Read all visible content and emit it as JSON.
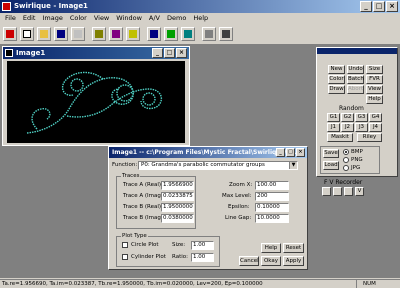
{
  "app": {
    "title": "Swirlique - Image1"
  },
  "menu": [
    "File",
    "Edit",
    "Image",
    "Color",
    "View",
    "Window",
    "A/V",
    "Demo",
    "Help"
  ],
  "child_window": {
    "title": "Image1"
  },
  "palette": {
    "row1": [
      "New",
      "Undo",
      "Size"
    ],
    "row2": [
      "Color",
      "Batch",
      "FVR"
    ],
    "row3": [
      "Draw",
      "Abort",
      "View"
    ],
    "help": "Help",
    "random_label": "Random",
    "random_row1": [
      "G1",
      "G2",
      "G3",
      "G4"
    ],
    "random_row2": [
      "J1",
      "J2",
      "J3",
      "J4"
    ],
    "maskit": "Maskit",
    "riley": "Riley",
    "save": "Save",
    "load": "Load",
    "formats": [
      "BMP",
      "PNG",
      "JPG"
    ],
    "fv_recorder": "F V Recorder",
    "v_btn": "V"
  },
  "dialog": {
    "title": "Image1 -- c:\\Program Files\\Mystic Fractal\\Swirlique\\Ut...",
    "function_label": "Function:",
    "function_value": "P0: Grandma's parabolic commutator groups",
    "traces_label": "Traces",
    "traces": [
      {
        "label": "Trace A (Real):",
        "value": "1.95669000"
      },
      {
        "label": "Trace A (Imag):",
        "value": "0.02338750"
      },
      {
        "label": "Trace B (Real):",
        "value": "1.95000000"
      },
      {
        "label": "Trace B (Imag):",
        "value": "0.03800000"
      }
    ],
    "params": [
      {
        "label": "Zoom X:",
        "value": "100.00"
      },
      {
        "label": "Max Level:",
        "value": "200"
      },
      {
        "label": "Epsilon:",
        "value": "0.10000"
      },
      {
        "label": "Line Gap:",
        "value": "10.0000"
      }
    ],
    "plot_type_label": "Plot Type",
    "circle_plot": "Circle Plot",
    "cylinder_plot": "Cylinder Plot",
    "size_label": "Size:",
    "size_value": "1.00",
    "ratio_label": "Ratio:",
    "ratio_value": "1.00",
    "help": "Help",
    "reset": "Reset",
    "cancel": "Cancel",
    "okay": "Okay",
    "apply": "Apply"
  },
  "status": {
    "text": "Ta.re=1.956690, Ta.im=0.023387, Tb.re=1.950000, Tb.im=0.020000, Lev=200, Ep=0.100000",
    "num": "NUM"
  },
  "colors": {
    "title_active": "#0a246a",
    "fractal": "#4fd1c5",
    "background": "#000000"
  }
}
